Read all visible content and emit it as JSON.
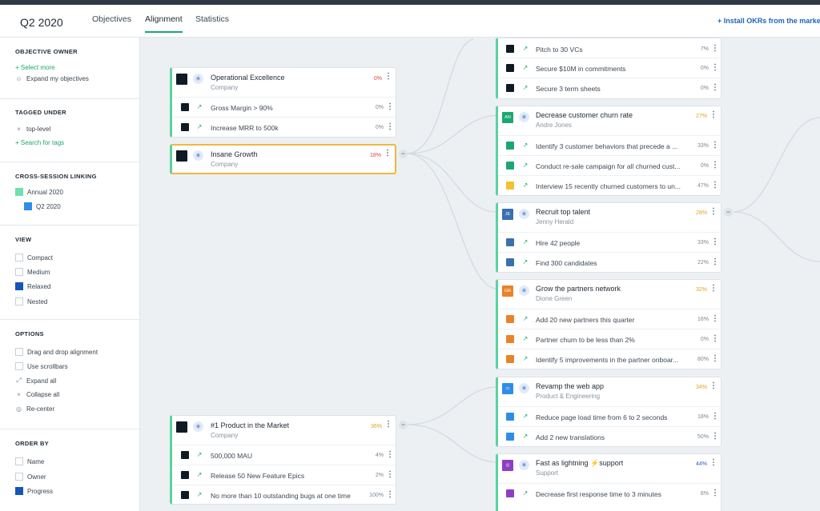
{
  "header": {
    "title": "Q2 2020",
    "tabs": [
      {
        "label": "Objectives"
      },
      {
        "label": "Alignment"
      },
      {
        "label": "Statistics"
      }
    ],
    "install_link": "+ Install OKRs from the marke"
  },
  "sidebar": {
    "objective_owner": {
      "title": "OBJECTIVE OWNER",
      "select_more": "+ Select more",
      "expand_mine": "Expand my objectives"
    },
    "tagged_under": {
      "title": "TAGGED UNDER",
      "tag": "top-level",
      "search_tags": "+ Search for tags"
    },
    "cross_session": {
      "title": "CROSS-SESSION LINKING",
      "items": [
        {
          "label": "Annual 2020",
          "color": "#6fe0b0"
        },
        {
          "label": "Q2 2020",
          "color": "#2e8ee6"
        }
      ]
    },
    "view": {
      "title": "VIEW",
      "options": [
        {
          "label": "Compact"
        },
        {
          "label": "Medium"
        },
        {
          "label": "Relaxed"
        },
        {
          "label": "Nested"
        }
      ],
      "selected": "Relaxed"
    },
    "options": {
      "title": "OPTIONS",
      "drag_drop": "Drag and drop alignment",
      "scrollbars": "Use scrollbars",
      "expand_all": "Expand all",
      "collapse_all": "Collapse all",
      "recenter": "Re-center"
    },
    "order_by": {
      "title": "ORDER BY",
      "options": [
        {
          "label": "Name"
        },
        {
          "label": "Owner"
        },
        {
          "label": "Progress"
        }
      ],
      "selected": "Progress"
    }
  },
  "cards": {
    "opex": {
      "name": "Operational Excellence",
      "owner": "Company",
      "progress": "0%",
      "krs": [
        {
          "text": "Gross Margin > 90%",
          "progress": "0%"
        },
        {
          "text": "Increase MRR to 500k",
          "progress": "0%"
        }
      ]
    },
    "growth": {
      "name": "Insane Growth",
      "owner": "Company",
      "progress": "18%"
    },
    "product": {
      "name": "#1 Product in the Market",
      "owner": "Company",
      "progress": "36%",
      "krs": [
        {
          "text": "500,000 MAU",
          "progress": "4%"
        },
        {
          "text": "Release 50 New Feature Epics",
          "progress": "2%"
        },
        {
          "text": "No more than 10 outstanding bugs at one time",
          "progress": "100%"
        }
      ]
    },
    "pitch": {
      "krs": [
        {
          "text": "Pitch to 30 VCs",
          "progress": "7%"
        },
        {
          "text": "Secure $10M in commitments",
          "progress": "0%"
        },
        {
          "text": "Secure 3 term sheets",
          "progress": "0%"
        }
      ]
    },
    "churn": {
      "name": "Decrease customer churn rate",
      "owner": "Andre Jones",
      "initials": "AN",
      "color": "#1aa772",
      "progress": "27%",
      "krs": [
        {
          "text": "Identify 3 customer behaviors that precede a ...",
          "progress": "33%"
        },
        {
          "text": "Conduct re-sale campaign for all churned cust...",
          "progress": "0%"
        },
        {
          "text": "Interview 15 recently churned customers to un...",
          "progress": "47%"
        }
      ]
    },
    "talent": {
      "name": "Recruit top talent",
      "owner": "Jenny Herald",
      "initials": "JE",
      "color": "#3a6fb0",
      "progress": "28%",
      "krs": [
        {
          "text": "Hire 42 people",
          "progress": "33%"
        },
        {
          "text": "Find 300 candidates",
          "progress": "22%"
        }
      ]
    },
    "partners": {
      "name": "Grow the partners network",
      "owner": "Dione Green",
      "initials": "GR",
      "color": "#e8832a",
      "progress": "32%",
      "krs": [
        {
          "text": "Add 20 new partners this quarter",
          "progress": "16%"
        },
        {
          "text": "Partner churn to be less than 2%",
          "progress": "0%"
        },
        {
          "text": "Identify 5 improvements in the partner onboar...",
          "progress": "80%"
        }
      ]
    },
    "webapp": {
      "name": "Revamp the web app",
      "owner": "Product & Engineering",
      "color": "#2e8ee6",
      "progress": "34%",
      "krs": [
        {
          "text": "Reduce page load time from 6 to 2 seconds",
          "progress": "18%"
        },
        {
          "text": "Add 2 new translations",
          "progress": "50%"
        }
      ]
    },
    "support": {
      "name": "Fast as lightning ⚡support",
      "owner": "Support",
      "color": "#8e3ec4",
      "progress": "44%",
      "krs": [
        {
          "text": "Decrease first response time to 3 minutes",
          "progress": "8%"
        }
      ]
    }
  }
}
